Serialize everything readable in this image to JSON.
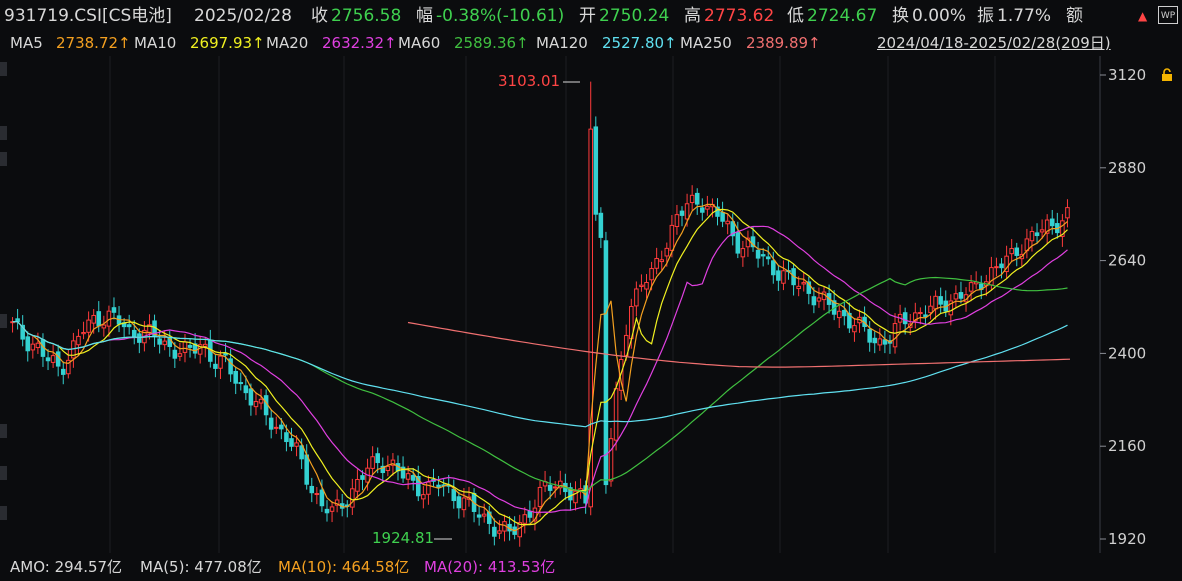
{
  "header": {
    "symbol": "931719.CSI[CS电池]",
    "date": "2025/02/28",
    "close_label": "收",
    "close_value": "2756.58",
    "change_label": "幅",
    "change_value": "-0.38%(-10.61)",
    "open_label": "开",
    "open_value": "2750.24",
    "high_label": "高",
    "high_value": "2773.62",
    "low_label": "低",
    "low_value": "2724.67",
    "turnover_label": "换",
    "turnover_value": "0.00%",
    "amplitude_label": "振",
    "amplitude_value": "1.77%",
    "amount_label": "额"
  },
  "ma_bar": {
    "items": [
      {
        "label": "MA5",
        "value": "2738.72↑",
        "color": "#f4a020"
      },
      {
        "label": "MA10",
        "value": "2697.93↑",
        "color": "#f0f020"
      },
      {
        "label": "MA20",
        "value": "2632.32↑",
        "color": "#e040e0"
      },
      {
        "label": "MA60",
        "value": "2589.36↑",
        "color": "#40c040"
      },
      {
        "label": "MA120",
        "value": "2527.80↑",
        "color": "#60e0f0"
      },
      {
        "label": "MA250",
        "value": "2389.89↑",
        "color": "#f07070"
      }
    ],
    "range": "2024/04/18-2025/02/28(209日)"
  },
  "y_axis": {
    "ticks": [
      "3120",
      "2880",
      "2640",
      "2400",
      "2160",
      "1920"
    ]
  },
  "annotations": {
    "high_mark": "3103.01",
    "low_mark": "1924.81"
  },
  "amo_bar": {
    "amo_label": "AMO: 294.57亿",
    "ma5_label": "MA(5): 477.08亿",
    "ma10_label": "MA(10): 464.58亿",
    "ma20_label": "MA(20): 413.53亿"
  },
  "colors": {
    "up": "#ff3b3b",
    "down": "#34d1d1",
    "label_white": "#d8d8d8",
    "green_value": "#3fd04f",
    "red_value": "#ff4545",
    "ma5": "#f4a020",
    "ma10": "#f0f020",
    "ma20": "#e040e0",
    "ma60": "#40c040",
    "ma120": "#60e0f0",
    "ma250": "#f07070"
  },
  "chart_data": {
    "type": "candlestick",
    "y_range": [
      1900,
      3160
    ],
    "series_close_approx": [
      2470,
      2440,
      2420,
      2380,
      2360,
      2410,
      2460,
      2490,
      2500,
      2480,
      2450,
      2460,
      2440,
      2420,
      2410,
      2400,
      2430,
      2380,
      2370,
      2330,
      2290,
      2250,
      2220,
      2190,
      2140,
      2070,
      2010,
      1985,
      2020,
      2060,
      2100,
      2125,
      2110,
      2080,
      2060,
      2050,
      2060,
      2040,
      2020,
      1990,
      1970,
      1945,
      1930,
      1970,
      2010,
      2050,
      2070,
      2040,
      2020,
      2010,
      2060,
      2300,
      2520,
      2580,
      2600,
      2680,
      2750,
      2780,
      2800,
      2770,
      2740,
      2690,
      2680,
      2650,
      2630,
      2600,
      2580,
      2570,
      2540,
      2520,
      2500,
      2480,
      2450,
      2430,
      2440,
      2480,
      2500,
      2510,
      2520,
      2540,
      2550,
      2560,
      2600,
      2620,
      2640,
      2680,
      2700,
      2720,
      2740,
      2756
    ]
  }
}
